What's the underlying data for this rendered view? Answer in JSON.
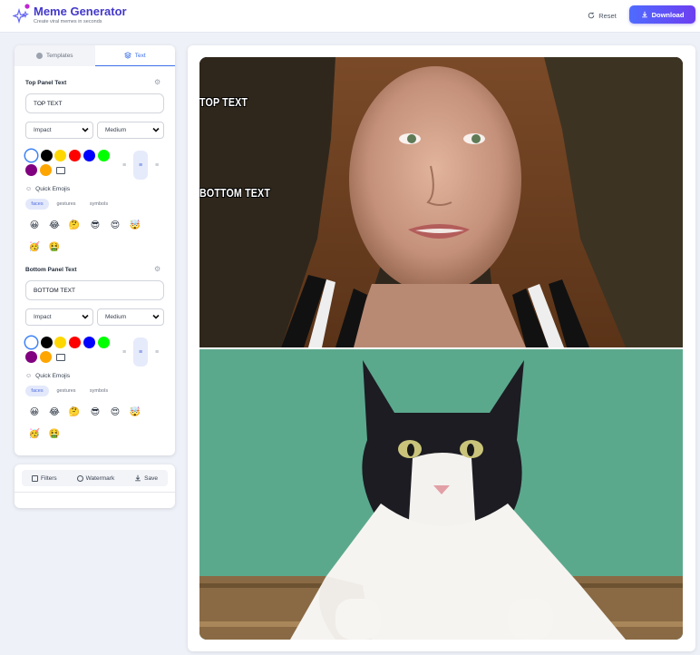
{
  "header": {
    "title": "Meme Generator",
    "subtitle": "Create viral memes in seconds",
    "reset_label": "Reset",
    "download_label": "Download"
  },
  "tabs": [
    {
      "label": "Templates",
      "icon": "template-icon",
      "active": false
    },
    {
      "label": "Text",
      "icon": "layers-icon",
      "active": true
    }
  ],
  "panels": [
    {
      "title": "Top Panel Text",
      "text_value": "TOP TEXT",
      "font": "Impact",
      "size": "Medium",
      "alignment": "center",
      "selected_color": "#ffffff",
      "emoji_label": "Quick Emojis",
      "emoji_tabs": [
        "faces",
        "gestures",
        "symbols"
      ],
      "active_emoji_tab": "faces",
      "emojis": [
        "😀",
        "😂",
        "🤔",
        "😎",
        "😍",
        "🤯",
        "🥳",
        "🤮"
      ]
    },
    {
      "title": "Bottom Panel Text",
      "text_value": "BOTTOM TEXT",
      "font": "Impact",
      "size": "Medium",
      "alignment": "center",
      "selected_color": "#ffffff",
      "emoji_label": "Quick Emojis",
      "emoji_tabs": [
        "faces",
        "gestures",
        "symbols"
      ],
      "active_emoji_tab": "faces",
      "emojis": [
        "😀",
        "😂",
        "🤔",
        "😎",
        "😍",
        "🤯",
        "🥳",
        "🤮"
      ]
    }
  ],
  "colors": [
    "#ffffff",
    "#000000",
    "#ffd700",
    "#ff0000",
    "#0000ff",
    "#00ff00",
    "#800080",
    "#ffa500",
    "transparent"
  ],
  "toolbar": [
    {
      "label": "Filters",
      "icon": "image-icon"
    },
    {
      "label": "Watermark",
      "icon": "droplet-icon"
    },
    {
      "label": "Save",
      "icon": "download-icon"
    }
  ],
  "canvas": {
    "top_text": "TOP TEXT",
    "bottom_text": "BOTTOM TEXT",
    "top_image": "woman-portrait-photo",
    "bottom_image": "cat-photo"
  },
  "theme": {
    "accent": "#3b6fe8",
    "download_gradient": [
      "#4f6bff",
      "#6d3ef0"
    ]
  }
}
